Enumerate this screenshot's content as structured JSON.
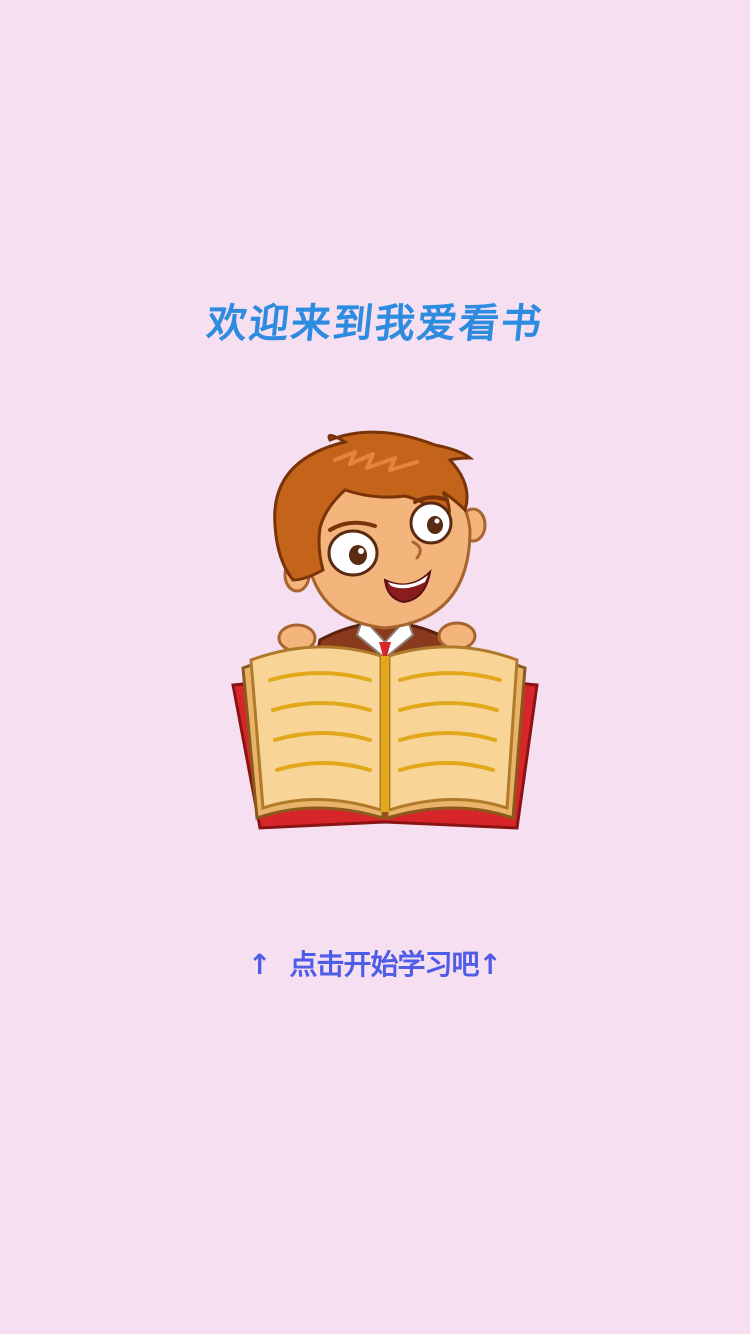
{
  "welcome": {
    "title": "欢迎来到我爱看书"
  },
  "illustration": {
    "icon": "boy-reading-book-illustration"
  },
  "start_prompt": {
    "label": "点击开始学习吧",
    "left_arrow": "↑",
    "right_arrow": "↑"
  },
  "colors": {
    "background": "#F5DFF0",
    "title": "#2E8CE0",
    "prompt": "#4F5CE8",
    "hair": "#C4631A",
    "skin": "#F3B57C",
    "book_page": "#F8D596",
    "book_cover": "#D7262A",
    "book_lines": "#E0A81A"
  }
}
